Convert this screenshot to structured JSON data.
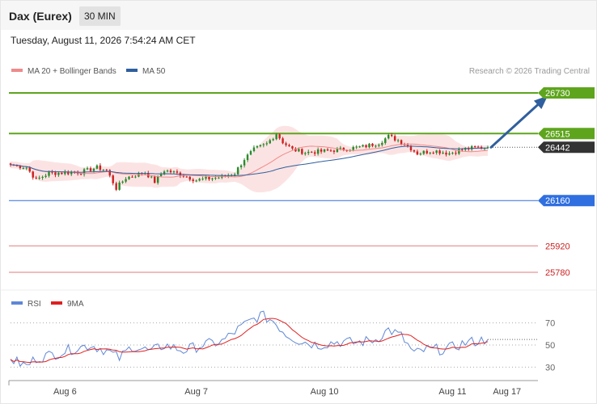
{
  "header": {
    "title": "Dax (Eurex)",
    "timeframe": "30 MIN",
    "timestamp": "Tuesday, August 11, 2026 7:54:24 AM CET"
  },
  "legend": [
    {
      "label": "MA 20 + Bollinger Bands",
      "color": "#f08a8a"
    },
    {
      "label": "MA 50",
      "color": "#2f5f9e"
    }
  ],
  "rsi_legend": [
    {
      "label": "RSI",
      "color": "#5f87d6"
    },
    {
      "label": "9MA",
      "color": "#e02020"
    }
  ],
  "credit": "Research © 2026 Trading Central",
  "colors": {
    "resistance": "#5ea51d",
    "support": "#2f6fe0",
    "support_extra": "#e27b7b",
    "current": "#333333",
    "up_candle": "#2b8a2b",
    "down_candle": "#cc2222",
    "band_fill": "#fbdede",
    "arrow": "#2f5f9e"
  },
  "chart_data": [
    {
      "type": "line",
      "title": "",
      "y_range": [
        25720,
        26790
      ],
      "x_ticks": [
        "Aug 6",
        "Aug 7",
        "Aug 10",
        "Aug 11",
        "Aug 17"
      ],
      "x_tick_positions_bars": [
        17,
        58,
        98,
        138,
        155
      ],
      "total_bars": 150,
      "projection_end_bar": 168,
      "levels": [
        {
          "value": 26730,
          "label": "26730",
          "kind": "resistance"
        },
        {
          "value": 26515,
          "label": "26515",
          "kind": "resistance"
        },
        {
          "value": 26442,
          "label": "26442",
          "kind": "current"
        },
        {
          "value": 26160,
          "label": "26160",
          "kind": "support"
        },
        {
          "value": 25920,
          "label": "25920",
          "kind": "support_extra"
        },
        {
          "value": 25780,
          "label": "25780",
          "kind": "support_extra"
        }
      ],
      "projection": {
        "from": 26442,
        "to": 26730
      },
      "price_keypoints": [
        {
          "bar": 0,
          "price": 26350
        },
        {
          "bar": 5,
          "price": 26335
        },
        {
          "bar": 8,
          "price": 26270
        },
        {
          "bar": 12,
          "price": 26305
        },
        {
          "bar": 22,
          "price": 26310
        },
        {
          "bar": 27,
          "price": 26335
        },
        {
          "bar": 30,
          "price": 26320
        },
        {
          "bar": 33,
          "price": 26225
        },
        {
          "bar": 36,
          "price": 26280
        },
        {
          "bar": 42,
          "price": 26310
        },
        {
          "bar": 45,
          "price": 26260
        },
        {
          "bar": 48,
          "price": 26320
        },
        {
          "bar": 53,
          "price": 26300
        },
        {
          "bar": 58,
          "price": 26268
        },
        {
          "bar": 66,
          "price": 26285
        },
        {
          "bar": 70,
          "price": 26305
        },
        {
          "bar": 73,
          "price": 26380
        },
        {
          "bar": 76,
          "price": 26430
        },
        {
          "bar": 80,
          "price": 26460
        },
        {
          "bar": 83,
          "price": 26515
        },
        {
          "bar": 85,
          "price": 26470
        },
        {
          "bar": 88,
          "price": 26430
        },
        {
          "bar": 92,
          "price": 26415
        },
        {
          "bar": 97,
          "price": 26420
        },
        {
          "bar": 103,
          "price": 26430
        },
        {
          "bar": 110,
          "price": 26445
        },
        {
          "bar": 115,
          "price": 26465
        },
        {
          "bar": 118,
          "price": 26500
        },
        {
          "bar": 121,
          "price": 26480
        },
        {
          "bar": 124,
          "price": 26450
        },
        {
          "bar": 127,
          "price": 26410
        },
        {
          "bar": 132,
          "price": 26425
        },
        {
          "bar": 137,
          "price": 26410
        },
        {
          "bar": 141,
          "price": 26430
        },
        {
          "bar": 145,
          "price": 26440
        },
        {
          "bar": 149,
          "price": 26442
        }
      ]
    },
    {
      "type": "line",
      "title": "",
      "y_range": [
        20,
        80
      ],
      "y_ticks": [
        30,
        50,
        70
      ],
      "dotted_level": 55,
      "rsi_keypoints": [
        {
          "bar": 0,
          "value": 37
        },
        {
          "bar": 5,
          "value": 31
        },
        {
          "bar": 8,
          "value": 38
        },
        {
          "bar": 14,
          "value": 42
        },
        {
          "bar": 20,
          "value": 47
        },
        {
          "bar": 25,
          "value": 50
        },
        {
          "bar": 30,
          "value": 45
        },
        {
          "bar": 34,
          "value": 38
        },
        {
          "bar": 38,
          "value": 49
        },
        {
          "bar": 44,
          "value": 44
        },
        {
          "bar": 48,
          "value": 50
        },
        {
          "bar": 54,
          "value": 45
        },
        {
          "bar": 60,
          "value": 50
        },
        {
          "bar": 66,
          "value": 53
        },
        {
          "bar": 70,
          "value": 62
        },
        {
          "bar": 74,
          "value": 70
        },
        {
          "bar": 78,
          "value": 77
        },
        {
          "bar": 82,
          "value": 72
        },
        {
          "bar": 86,
          "value": 60
        },
        {
          "bar": 90,
          "value": 54
        },
        {
          "bar": 96,
          "value": 50
        },
        {
          "bar": 102,
          "value": 53
        },
        {
          "bar": 108,
          "value": 52
        },
        {
          "bar": 114,
          "value": 55
        },
        {
          "bar": 118,
          "value": 64
        },
        {
          "bar": 122,
          "value": 58
        },
        {
          "bar": 126,
          "value": 42
        },
        {
          "bar": 130,
          "value": 46
        },
        {
          "bar": 136,
          "value": 46
        },
        {
          "bar": 142,
          "value": 52
        },
        {
          "bar": 149,
          "value": 55
        }
      ]
    }
  ]
}
